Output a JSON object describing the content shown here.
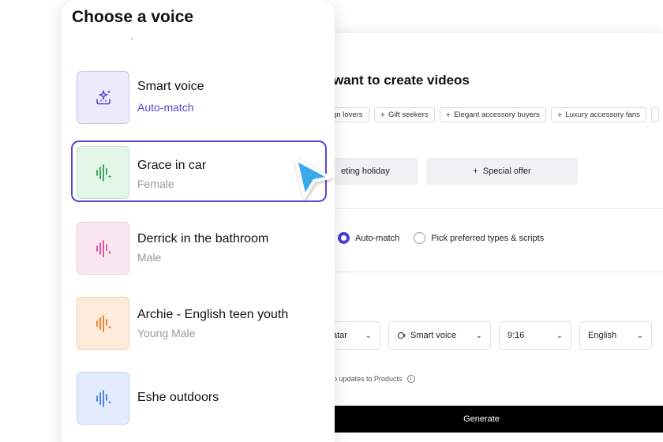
{
  "background": {
    "title": "want to create videos",
    "chips": [
      {
        "label": "gn lovers",
        "plus": false
      },
      {
        "label": "Gift seekers",
        "plus": true
      },
      {
        "label": "Elegant accessory buyers",
        "plus": true
      },
      {
        "label": "Luxury accessory fans",
        "plus": true
      }
    ],
    "pills": [
      "eting holiday",
      "Special offer"
    ],
    "radios": [
      "Auto-match",
      "Pick preferred types & scripts"
    ],
    "selects": [
      "atar",
      "Smart voice",
      "9:16",
      "English"
    ],
    "note": "o updates to Products",
    "generate_label": "Generate"
  },
  "panel": {
    "title": "Choose a voice",
    "voices": [
      {
        "name": "Smart voice",
        "sub": "Auto-match",
        "icon": "sparkle-voice-icon",
        "color": "#5a46d6"
      },
      {
        "name": "Grace in car",
        "sub": "Female",
        "icon": "waveform-icon",
        "color": "#2f9e50",
        "selected": true
      },
      {
        "name": "Derrick in the bathroom",
        "sub": "Male",
        "icon": "waveform-icon",
        "color": "#e0479a"
      },
      {
        "name": "Archie - English teen youth",
        "sub": "Young Male",
        "icon": "waveform-icon",
        "color": "#f07a1e"
      },
      {
        "name": "Eshe outdoors",
        "sub": "",
        "icon": "waveform-icon",
        "color": "#3b7de8"
      }
    ]
  },
  "colors": {
    "accent": "#5a46d6",
    "cursor": "#3aa8e8"
  }
}
